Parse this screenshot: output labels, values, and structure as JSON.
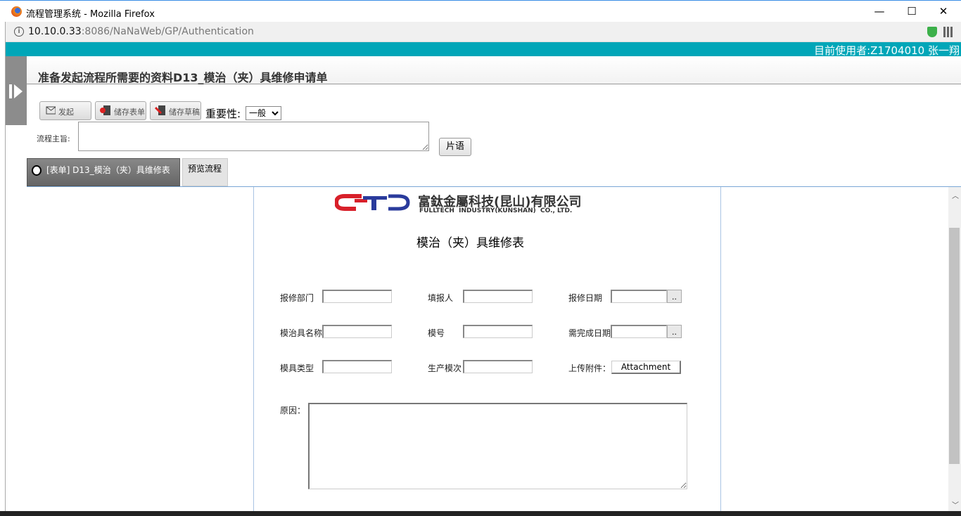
{
  "window": {
    "title": "流程管理系统 - Mozilla Firefox",
    "minimize": "—",
    "maximize": "☐",
    "close": "✕"
  },
  "address": {
    "host": "10.10.0.33",
    "path": ":8086/NaNaWeb/GP/Authentication"
  },
  "topbar": {
    "user": "目前使用者:Z1704010 张一翔"
  },
  "header": {
    "title": "准备发起流程所需要的资料D13_模治（夹）具维修申请单"
  },
  "toolbar": {
    "launch": "发起",
    "save_form": "储存表单",
    "save_draft": "储存草稿",
    "importance_label": "重要性:",
    "importance_value": "一般"
  },
  "subject": {
    "label": "流程主旨:",
    "value": "",
    "phrase_button": "片语"
  },
  "tabs": [
    {
      "label": "[表单] D13_模治（夹）具维修表"
    },
    {
      "label": "预览流程"
    }
  ],
  "form": {
    "logo_cn": "富鈦金屬科技(昆山)有限公司",
    "logo_en": "FULLTECH  INDUSTRY(KUNSHAN)  CO., LTD.",
    "logo_mark": "FT",
    "title": "模治（夹）具维修表",
    "fields": {
      "dept": "报修部门",
      "filler": "填报人",
      "date": "报修日期",
      "name": "模治具名称",
      "model": "模号",
      "due": "需完成日期",
      "type": "模具类型",
      "batch": "生产模次",
      "attach": "上传附件：",
      "reason": "原因："
    },
    "attach_button": "Attachment",
    "date_button": ".."
  },
  "colors": {
    "teal": "#00a6b8",
    "logo_red": "#d8202a",
    "logo_blue": "#2a3b9c"
  }
}
